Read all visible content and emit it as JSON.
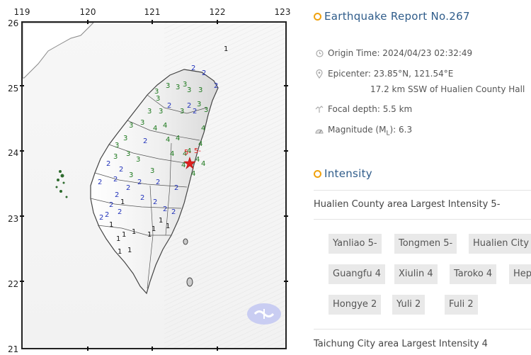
{
  "map": {
    "longitudes": [
      "119",
      "120",
      "121",
      "122",
      "123"
    ],
    "latitudes": [
      "26",
      "25",
      "24",
      "23",
      "22",
      "21"
    ],
    "epicenter_marker": "red-star",
    "offshore_label": "1",
    "logo": "cwa-logo",
    "intensity_labels": [
      {
        "text": "2",
        "level": "2"
      },
      {
        "text": "2",
        "level": "2"
      },
      {
        "text": "2",
        "level": "2"
      },
      {
        "text": "3",
        "level": "3"
      },
      {
        "text": "3",
        "level": "3"
      },
      {
        "text": "3",
        "level": "3"
      },
      {
        "text": "3",
        "level": "3"
      },
      {
        "text": "3",
        "level": "3"
      },
      {
        "text": "3",
        "level": "3"
      },
      {
        "text": "3",
        "level": "3"
      },
      {
        "text": "2",
        "level": "2"
      },
      {
        "text": "2",
        "level": "2"
      },
      {
        "text": "3",
        "level": "3"
      },
      {
        "text": "3",
        "level": "3"
      },
      {
        "text": "3",
        "level": "3"
      },
      {
        "text": "3",
        "level": "3"
      },
      {
        "text": "2",
        "level": "2"
      },
      {
        "text": "3",
        "level": "3"
      },
      {
        "text": "3",
        "level": "3"
      },
      {
        "text": "4",
        "level": "4"
      },
      {
        "text": "4",
        "level": "4"
      },
      {
        "text": "3",
        "level": "3"
      },
      {
        "text": "3",
        "level": "3"
      },
      {
        "text": "3",
        "level": "3"
      },
      {
        "text": "4",
        "level": "4"
      },
      {
        "text": "4",
        "level": "4"
      },
      {
        "text": "4",
        "level": "4"
      },
      {
        "text": "3",
        "level": "3"
      },
      {
        "text": "3",
        "level": "3"
      },
      {
        "text": "4",
        "level": "4"
      },
      {
        "text": "4",
        "level": "4"
      },
      {
        "text": "4",
        "level": "4"
      },
      {
        "text": "2",
        "level": "2"
      },
      {
        "text": "3",
        "level": "3"
      },
      {
        "text": "3",
        "level": "3"
      },
      {
        "text": "4",
        "level": "4"
      },
      {
        "text": "4",
        "level": "4"
      },
      {
        "text": "5-",
        "level": "5-"
      },
      {
        "text": "5-",
        "level": "5-"
      },
      {
        "text": "4",
        "level": "4"
      },
      {
        "text": "4",
        "level": "4"
      },
      {
        "text": "4",
        "level": "4"
      },
      {
        "text": "2",
        "level": "2"
      },
      {
        "text": "2",
        "level": "2"
      },
      {
        "text": "2",
        "level": "2"
      },
      {
        "text": "3",
        "level": "3"
      },
      {
        "text": "2",
        "level": "2"
      },
      {
        "text": "2",
        "level": "2"
      },
      {
        "text": "2",
        "level": "2"
      },
      {
        "text": "2",
        "level": "2"
      },
      {
        "text": "2",
        "level": "2"
      },
      {
        "text": "2",
        "level": "2"
      },
      {
        "text": "2",
        "level": "2"
      },
      {
        "text": "2",
        "level": "2"
      },
      {
        "text": "2",
        "level": "2"
      },
      {
        "text": "2",
        "level": "2"
      },
      {
        "text": "2",
        "level": "2"
      },
      {
        "text": "2",
        "level": "2"
      },
      {
        "text": "2",
        "level": "2"
      },
      {
        "text": "2",
        "level": "2"
      },
      {
        "text": "1",
        "level": "1"
      },
      {
        "text": "1",
        "level": "1"
      },
      {
        "text": "1",
        "level": "1"
      },
      {
        "text": "1",
        "level": "1"
      },
      {
        "text": "1",
        "level": "1"
      },
      {
        "text": "1",
        "level": "1"
      },
      {
        "text": "1",
        "level": "1"
      },
      {
        "text": "1",
        "level": "1"
      },
      {
        "text": "1",
        "level": "1"
      },
      {
        "text": "1",
        "level": "1"
      },
      {
        "text": "1",
        "level": "1"
      }
    ]
  },
  "colors": {
    "level_1": "#111111",
    "level_2": "#2233bb",
    "level_3": "#1f7a1f",
    "level_4": "#1f7a1f",
    "level_5-": "#e0201e",
    "title": "#2f5c8a",
    "dot": "#f0a20f"
  },
  "report": {
    "title": "Earthquake Report No.267",
    "origin_time": "Origin Time: 2024/04/23 02:32:49",
    "epicenter": "Epicenter: 23.85°N, 121.54°E",
    "epicenter_detail": "17.2 km SSW of Hualien County Hall",
    "focal_depth": "Focal depth: 5.5 km",
    "magnitude_prefix": "Magnitude (M",
    "magnitude_sub": "L",
    "magnitude_suffix": "): 6.3",
    "icons": [
      "clock-icon",
      "pin-icon",
      "depth-icon",
      "magnitude-icon"
    ]
  },
  "intensity": {
    "title": "Intensity",
    "areas": [
      {
        "heading": "Hualien County area Largest Intensity 5-",
        "stations": [
          "Yanliao 5-",
          "Tongmen 5-",
          "Hualien City",
          "Guangfu 4",
          "Xiulin 4",
          "Taroko 4",
          "Hep",
          "Hongye 2",
          "Yuli 2",
          "Fuli 2"
        ]
      },
      {
        "heading": "Taichung City area Largest Intensity 4"
      }
    ]
  }
}
